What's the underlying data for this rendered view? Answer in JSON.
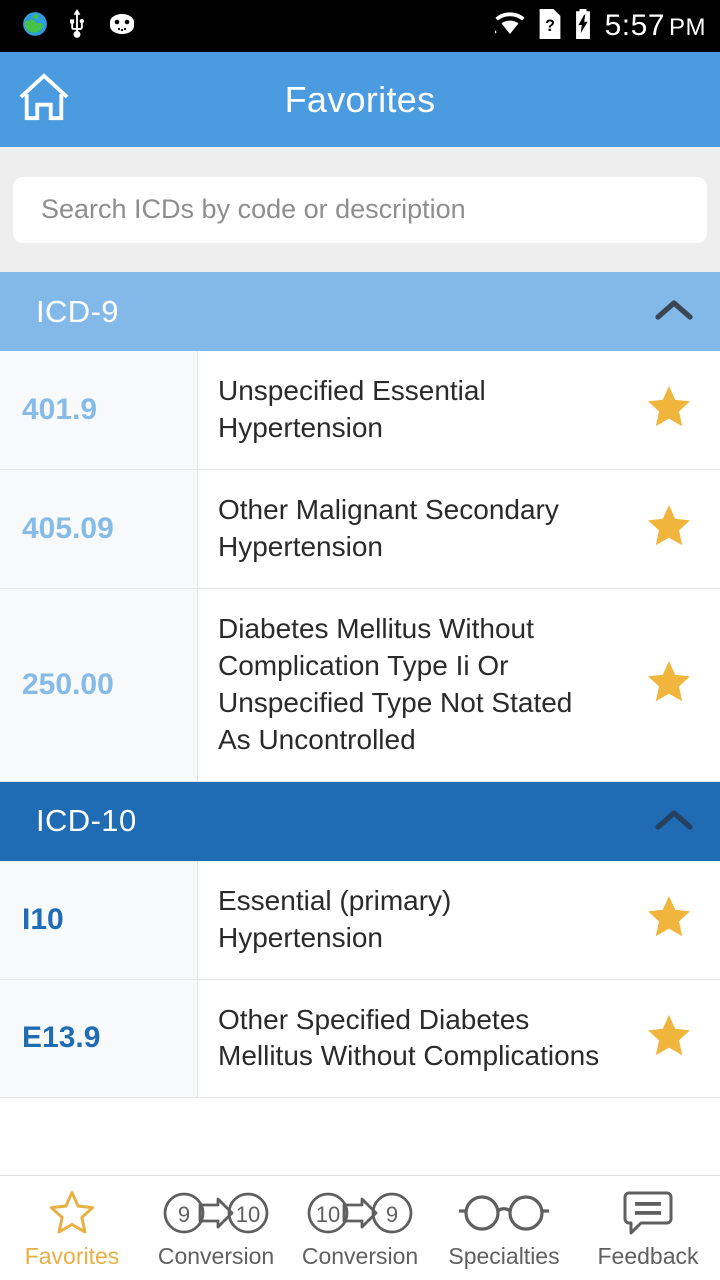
{
  "status_bar": {
    "icons": [
      "globe-icon",
      "usb-icon",
      "android-robot-icon"
    ],
    "right_icons": [
      "wifi-icon",
      "sim-card-missing-icon",
      "battery-charging-icon"
    ],
    "time": "5:57",
    "ampm": "PM"
  },
  "app_bar": {
    "home_icon": "home-icon",
    "title": "Favorites"
  },
  "search": {
    "placeholder": "Search ICDs by code or description",
    "value": ""
  },
  "colors": {
    "app_bar": "#4a9be0",
    "icd9_header": "#83b9e8",
    "icd10_header": "#1f6cb5",
    "icd9_code": "#86bbe8",
    "icd10_code": "#1f6cb5",
    "star": "#f0b53c",
    "active_nav": "#e8b044",
    "search_zone": "#eeeeee"
  },
  "sections": [
    {
      "label": "ICD-9",
      "collapse_icon": "chevron-up-icon",
      "expanded": true,
      "rows": [
        {
          "code": "401.9",
          "description": "Unspecified Essential Hypertension",
          "favorited": true,
          "star_icon": "star-filled-icon"
        },
        {
          "code": "405.09",
          "description": "Other Malignant Secondary Hypertension",
          "favorited": true,
          "star_icon": "star-filled-icon"
        },
        {
          "code": "250.00",
          "description": "Diabetes Mellitus Without Complication Type Ii Or Unspecified Type Not Stated As Uncontrolled",
          "favorited": true,
          "star_icon": "star-filled-icon"
        }
      ]
    },
    {
      "label": "ICD-10",
      "collapse_icon": "chevron-up-icon",
      "expanded": true,
      "rows": [
        {
          "code": "I10",
          "description": "Essential (primary) Hypertension",
          "favorited": true,
          "star_icon": "star-filled-icon"
        },
        {
          "code": "E13.9",
          "description": "Other Specified Diabetes Mellitus Without Complications",
          "favorited": true,
          "star_icon": "star-filled-icon"
        }
      ]
    }
  ],
  "bottom_nav": {
    "items": [
      {
        "label": "Favorites",
        "icon": "star-outline-icon",
        "active": true
      },
      {
        "label": "Conversion",
        "icon": "convert-9-to-10-icon",
        "active": false
      },
      {
        "label": "Conversion",
        "icon": "convert-10-to-9-icon",
        "active": false
      },
      {
        "label": "Specialties",
        "icon": "glasses-icon",
        "active": false
      },
      {
        "label": "Feedback",
        "icon": "speech-bubble-icon",
        "active": false
      }
    ]
  }
}
